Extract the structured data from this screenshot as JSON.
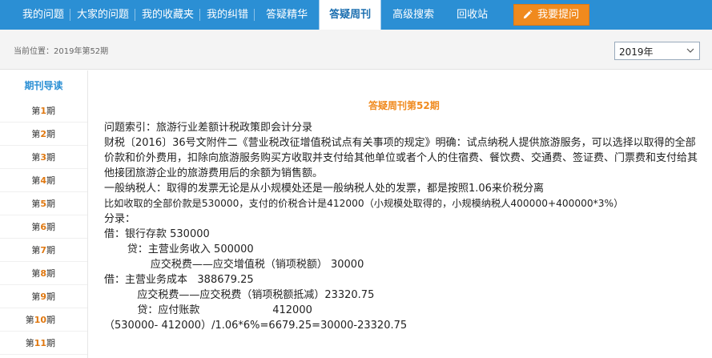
{
  "nav": {
    "items": [
      {
        "label": "我的问题"
      },
      {
        "label": "大家的问题"
      },
      {
        "label": "我的收藏夹"
      },
      {
        "label": "我的纠错"
      },
      {
        "label": "答疑精华"
      },
      {
        "label": "答疑周刊"
      },
      {
        "label": "高级搜索"
      },
      {
        "label": "回收站"
      }
    ],
    "ask_label": "我要提问"
  },
  "breadcrumb": "当前位置：2019年第52期",
  "year_select": {
    "value": "2019年"
  },
  "sidebar": {
    "title": "期刊导读",
    "items": [
      {
        "pre": "第",
        "num": "1",
        "post": "期"
      },
      {
        "pre": "第",
        "num": "2",
        "post": "期"
      },
      {
        "pre": "第",
        "num": "3",
        "post": "期"
      },
      {
        "pre": "第",
        "num": "4",
        "post": "期"
      },
      {
        "pre": "第",
        "num": "5",
        "post": "期"
      },
      {
        "pre": "第",
        "num": "6",
        "post": "期"
      },
      {
        "pre": "第",
        "num": "7",
        "post": "期"
      },
      {
        "pre": "第",
        "num": "8",
        "post": "期"
      },
      {
        "pre": "第",
        "num": "9",
        "post": "期"
      },
      {
        "pre": "第",
        "num": "10",
        "post": "期"
      },
      {
        "pre": "第",
        "num": "11",
        "post": "期"
      }
    ]
  },
  "article": {
    "title": "答疑周刊第52期",
    "lines": [
      "问题索引：旅游行业差额计税政策即会计分录",
      "财税〔2016〕36号文附件二《营业税改征增值税试点有关事项的规定》明确：试点纳税人提供旅游服务，可以选择以取得的全部价款和价外费用，扣除向旅游服务购买方收取并支付给其他单位或者个人的住宿费、餐饮费、交通费、签证费、门票费和支付给其他接团旅游企业的旅游费用后的余额为销售额。",
      "一般纳税人：取得的发票无论是从小规模处还是一般纳税人处的发票，都是按照1.06来价税分离",
      "比如收取的全部价款是530000，支付的价税合计是412000（小规模处取得的，小规模纳税人400000+400000*3%）",
      "分录：",
      "借：银行存款 530000",
      "       贷：主营业务收入 500000",
      "              应交税费——应交增值税（销项税额） 30000",
      "借：主营业务成本   388679.25",
      "          应交税费——应交税费（销项税额抵减）23320.75",
      "          贷：应付账款                      412000",
      "（530000- 412000）/1.06*6%=6679.25=30000-23320.75"
    ]
  }
}
